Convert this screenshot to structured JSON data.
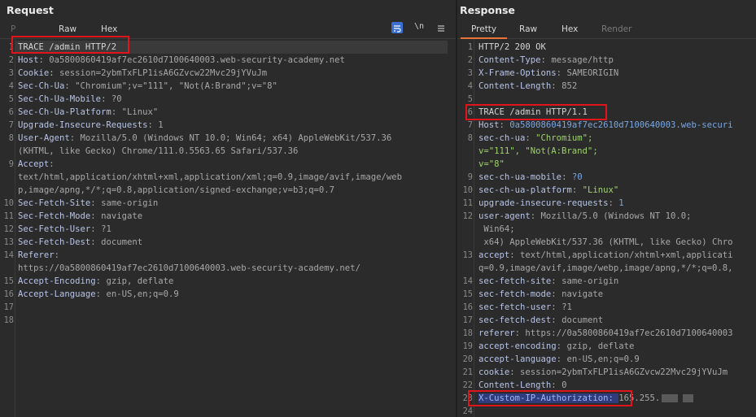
{
  "request": {
    "title": "Request",
    "tabs": [
      "P",
      "Raw",
      "Hex"
    ],
    "icons": [
      "wrap-lines-icon",
      "newline-icon",
      "menu-icon"
    ],
    "newline_label": "\\n",
    "lines": [
      {
        "n": "1",
        "k": "",
        "v": "TRACE /admin HTTP/2"
      },
      {
        "n": "2",
        "k": "Host",
        "v": "0a5800860419af7ec2610d7100640003.web-security-academy.net"
      },
      {
        "n": "3",
        "k": "Cookie",
        "v": "session=2ybmTxFLP1isA6GZvcw22Mvc29jYVuJm"
      },
      {
        "n": "4",
        "k": "Sec-Ch-Ua",
        "v": "\"Chromium\";v=\"111\", \"Not(A:Brand\";v=\"8\""
      },
      {
        "n": "5",
        "k": "Sec-Ch-Ua-Mobile",
        "v": "?0"
      },
      {
        "n": "6",
        "k": "Sec-Ch-Ua-Platform",
        "v": "\"Linux\""
      },
      {
        "n": "7",
        "k": "Upgrade-Insecure-Requests",
        "v": "1"
      },
      {
        "n": "8",
        "k": "User-Agent",
        "v": "Mozilla/5.0 (Windows NT 10.0; Win64; x64) AppleWebKit/537.36"
      },
      {
        "n": "",
        "k": "",
        "v": "(KHTML, like Gecko) Chrome/111.0.5563.65 Safari/537.36"
      },
      {
        "n": "9",
        "k": "Accept",
        "v": ""
      },
      {
        "n": "",
        "k": "",
        "v": "text/html,application/xhtml+xml,application/xml;q=0.9,image/avif,image/web"
      },
      {
        "n": "",
        "k": "",
        "v": "p,image/apng,*/*;q=0.8,application/signed-exchange;v=b3;q=0.7"
      },
      {
        "n": "10",
        "k": "Sec-Fetch-Site",
        "v": "same-origin"
      },
      {
        "n": "11",
        "k": "Sec-Fetch-Mode",
        "v": "navigate"
      },
      {
        "n": "12",
        "k": "Sec-Fetch-User",
        "v": "?1"
      },
      {
        "n": "13",
        "k": "Sec-Fetch-Dest",
        "v": "document"
      },
      {
        "n": "14",
        "k": "Referer",
        "v": ""
      },
      {
        "n": "",
        "k": "",
        "v": "https://0a5800860419af7ec2610d7100640003.web-security-academy.net/"
      },
      {
        "n": "15",
        "k": "Accept-Encoding",
        "v": "gzip, deflate"
      },
      {
        "n": "16",
        "k": "Accept-Language",
        "v": "en-US,en;q=0.9"
      },
      {
        "n": "17",
        "k": "",
        "v": ""
      },
      {
        "n": "18",
        "k": "",
        "v": ""
      }
    ]
  },
  "response": {
    "title": "Response",
    "tabs": [
      "Pretty",
      "Raw",
      "Hex",
      "Render"
    ],
    "status_line": "HTTP/2 200 OK",
    "lines": [
      {
        "n": "1",
        "k": "",
        "v": "HTTP/2 200 OK"
      },
      {
        "n": "2",
        "k": "Content-Type",
        "v": "message/http"
      },
      {
        "n": "3",
        "k": "X-Frame-Options",
        "v": "SAMEORIGIN"
      },
      {
        "n": "4",
        "k": "Content-Length",
        "v": "852"
      },
      {
        "n": "5",
        "k": "",
        "v": ""
      },
      {
        "n": "6",
        "k": "",
        "v": "TRACE /admin HTTP/1.1"
      },
      {
        "n": "7",
        "k": "Host",
        "v": "0a5800860419af7ec2610d7100640003.web-securi"
      },
      {
        "n": "8",
        "k": "sec-ch-ua",
        "v": "\"Chromium\";"
      },
      {
        "n": "",
        "k": "",
        "v": "v=\"111\", \"Not(A:Brand\";"
      },
      {
        "n": "",
        "k": "",
        "v": "v=\"8\""
      },
      {
        "n": "9",
        "k": "sec-ch-ua-mobile",
        "v": "?0"
      },
      {
        "n": "10",
        "k": "sec-ch-ua-platform",
        "v": "\"Linux\""
      },
      {
        "n": "11",
        "k": "upgrade-insecure-requests",
        "v": "1"
      },
      {
        "n": "12",
        "k": "user-agent",
        "v": "Mozilla/5.0 (Windows NT 10.0;"
      },
      {
        "n": "",
        "k": "",
        "v": " Win64;"
      },
      {
        "n": "",
        "k": "",
        "v": " x64) AppleWebKit/537.36 (KHTML, like Gecko) Chro"
      },
      {
        "n": "13",
        "k": "accept",
        "v": "text/html,application/xhtml+xml,applicati"
      },
      {
        "n": "",
        "k": "",
        "v": "q=0.9,image/avif,image/webp,image/apng,*/*;q=0.8,"
      },
      {
        "n": "14",
        "k": "sec-fetch-site",
        "v": "same-origin"
      },
      {
        "n": "15",
        "k": "sec-fetch-mode",
        "v": "navigate"
      },
      {
        "n": "16",
        "k": "sec-fetch-user",
        "v": "?1"
      },
      {
        "n": "17",
        "k": "sec-fetch-dest",
        "v": "document"
      },
      {
        "n": "18",
        "k": "referer",
        "v": "https://0a5800860419af7ec2610d7100640003"
      },
      {
        "n": "19",
        "k": "accept-encoding",
        "v": "gzip, deflate"
      },
      {
        "n": "20",
        "k": "accept-language",
        "v": "en-US,en;q=0.9"
      },
      {
        "n": "21",
        "k": "cookie",
        "v": "session=2ybmTxFLP1isA6GZvcw22Mvc29jYVuJm"
      },
      {
        "n": "22",
        "k": "Content-Length",
        "v": "0"
      },
      {
        "n": "23",
        "k": "X-Custom-IP-Authorization",
        "v": "165.255."
      },
      {
        "n": "24",
        "k": "",
        "v": ""
      }
    ]
  },
  "colors": {
    "accent": "#e8743b",
    "highlight_box": "#e0151c",
    "selection": "#2f3b7a"
  }
}
